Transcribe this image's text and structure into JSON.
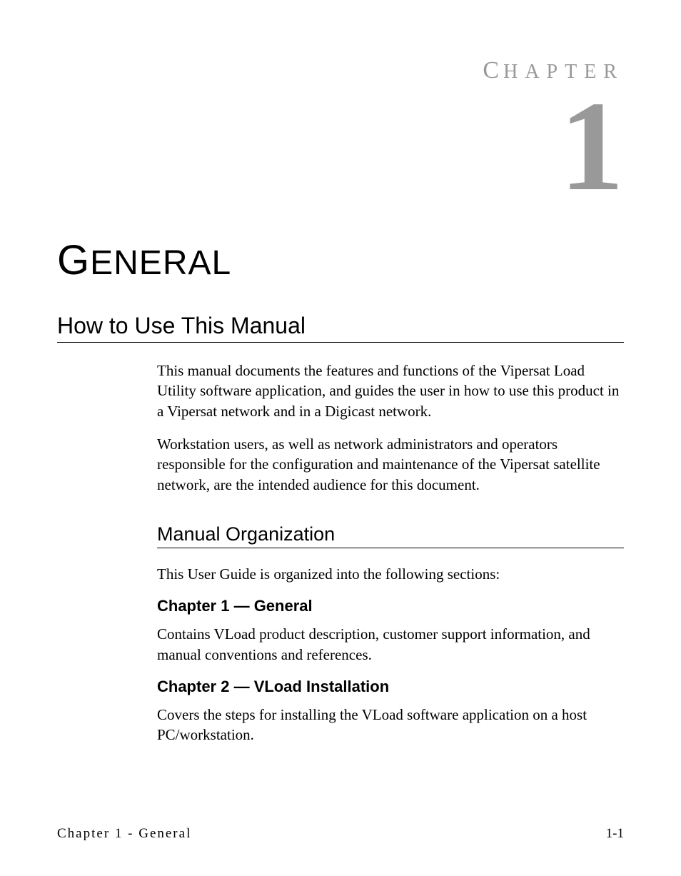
{
  "chapter_label": "HAPTER",
  "chapter_label_first": "C",
  "chapter_number": "1",
  "chapter_title_first": "G",
  "chapter_title_rest": "ENERAL",
  "section1": {
    "heading": "How to Use This Manual",
    "para1": "This manual documents the features and functions of the Vipersat Load Utility software application, and guides the user in how to use this product in a Vipersat network and in a Digicast network.",
    "para2": "Workstation users, as well as network administrators and operators responsible for the configuration and maintenance of the Vipersat satellite network, are the intended audience for this document."
  },
  "subsection1": {
    "heading": "Manual Organization",
    "intro": "This User Guide is organized into the following sections:",
    "chapters": [
      {
        "title": "Chapter 1 — General",
        "desc": "Contains VLoad product description, customer support information, and manual conventions and references."
      },
      {
        "title": "Chapter 2 — VLoad Installation",
        "desc": "Covers the steps for installing the VLoad software application on a host PC/workstation."
      }
    ]
  },
  "footer": {
    "left": "Chapter 1 - General",
    "right": "1-1"
  }
}
